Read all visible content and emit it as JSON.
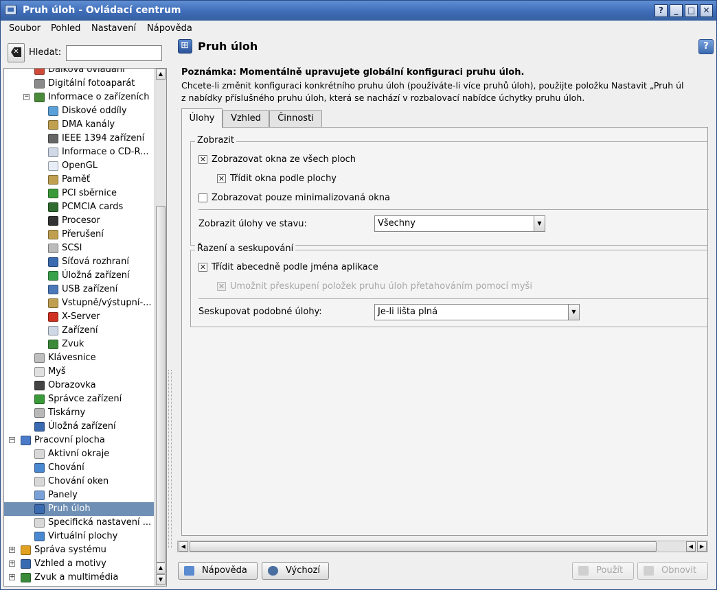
{
  "window": {
    "title": "Pruh úloh - Ovládací centrum",
    "buttons": [
      "?",
      "_",
      "□",
      "✕"
    ]
  },
  "menu": [
    "Soubor",
    "Pohled",
    "Nastavení",
    "Nápověda"
  ],
  "search": {
    "label": "Hledat:",
    "value": ""
  },
  "tree": {
    "items": [
      {
        "label": "Dálková ovládání",
        "level": 2,
        "color": "#d04a3a",
        "icon": "remote-icon"
      },
      {
        "label": "Digitální fotoaparát",
        "level": 2,
        "color": "#8a8a8a",
        "icon": "camera-icon"
      },
      {
        "label": "Informace o zařízeních",
        "level": 2,
        "color": "#4b8a3a",
        "icon": "info-icon",
        "expanded": true
      },
      {
        "label": "Diskové oddíly",
        "level": 3,
        "color": "#5aa0d8",
        "icon": "partition-icon"
      },
      {
        "label": "DMA kanály",
        "level": 3,
        "color": "#c0a050",
        "icon": "chip-icon"
      },
      {
        "label": "IEEE 1394 zařízení",
        "level": 3,
        "color": "#666666",
        "icon": "firewire-icon"
      },
      {
        "label": "Informace o CD-R...",
        "level": 3,
        "color": "#cfd8e6",
        "icon": "cdrom-icon"
      },
      {
        "label": "OpenGL",
        "level": 3,
        "color": "#e8eef8",
        "icon": "opengl-icon"
      },
      {
        "label": "Paměť",
        "level": 3,
        "color": "#c0a050",
        "icon": "memory-icon"
      },
      {
        "label": "PCI sběrnice",
        "level": 3,
        "color": "#3a9a3a",
        "icon": "pci-icon"
      },
      {
        "label": "PCMCIA cards",
        "level": 3,
        "color": "#2f6b2f",
        "icon": "pcmcia-icon"
      },
      {
        "label": "Procesor",
        "level": 3,
        "color": "#333333",
        "icon": "cpu-icon"
      },
      {
        "label": "Přerušení",
        "level": 3,
        "color": "#c0a050",
        "icon": "irq-icon"
      },
      {
        "label": "SCSI",
        "level": 3,
        "color": "#bbbbbb",
        "icon": "scsi-icon"
      },
      {
        "label": "Síťová rozhraní",
        "level": 3,
        "color": "#3a6ab0",
        "icon": "network-icon"
      },
      {
        "label": "Úložná zařízení",
        "level": 3,
        "color": "#3aa04a",
        "icon": "storage-icon"
      },
      {
        "label": "USB zařízení",
        "level": 3,
        "color": "#4a78b8",
        "icon": "usb-icon"
      },
      {
        "label": "Vstupně/výstupní-...",
        "level": 3,
        "color": "#c0a050",
        "icon": "io-icon"
      },
      {
        "label": "X-Server",
        "level": 3,
        "color": "#d03020",
        "icon": "xserver-icon"
      },
      {
        "label": "Zařízení",
        "level": 3,
        "color": "#cfd8e6",
        "icon": "devices-icon"
      },
      {
        "label": "Zvuk",
        "level": 3,
        "color": "#3a8a3a",
        "icon": "sound-icon"
      },
      {
        "label": "Klávesnice",
        "level": 2,
        "color": "#bfbfbf",
        "icon": "keyboard-icon"
      },
      {
        "label": "Myš",
        "level": 2,
        "color": "#e0e0e0",
        "icon": "mouse-icon"
      },
      {
        "label": "Obrazovka",
        "level": 2,
        "color": "#444444",
        "icon": "display-icon"
      },
      {
        "label": "Správce zařízení",
        "level": 2,
        "color": "#3a9a3a",
        "icon": "device-manager-icon"
      },
      {
        "label": "Tiskárny",
        "level": 2,
        "color": "#b8b8b8",
        "icon": "printer-icon"
      },
      {
        "label": "Úložná zařízení",
        "level": 2,
        "color": "#3a6ab0",
        "icon": "storage-icon"
      },
      {
        "label": "Pracovní plocha",
        "level": 1,
        "color": "#4a7ac8",
        "icon": "desktop-icon",
        "expanded": true
      },
      {
        "label": "Aktivní okraje",
        "level": 2,
        "color": "#d8d8d8",
        "icon": "borders-icon"
      },
      {
        "label": "Chování",
        "level": 2,
        "color": "#4a88d0",
        "icon": "behavior-icon"
      },
      {
        "label": "Chování oken",
        "level": 2,
        "color": "#d8d8d8",
        "icon": "window-behavior-icon"
      },
      {
        "label": "Panely",
        "level": 2,
        "color": "#7aa0d8",
        "icon": "panels-icon"
      },
      {
        "label": "Pruh úloh",
        "level": 2,
        "color": "#3a6ab0",
        "icon": "taskbar-icon",
        "selected": true
      },
      {
        "label": "Specifická nastavení ...",
        "level": 2,
        "color": "#d8d8d8",
        "icon": "window-specific-icon"
      },
      {
        "label": "Virtuální plochy",
        "level": 2,
        "color": "#4a88d0",
        "icon": "virtual-desktops-icon"
      },
      {
        "label": "Správa systému",
        "level": 1,
        "color": "#e0a020",
        "icon": "system-admin-icon",
        "collapsed": true
      },
      {
        "label": "Vzhled a motivy",
        "level": 1,
        "color": "#3a6ab0",
        "icon": "appearance-icon",
        "collapsed": true
      },
      {
        "label": "Zvuk a multimédia",
        "level": 1,
        "color": "#3a8a3a",
        "icon": "multimedia-icon",
        "collapsed": true
      }
    ]
  },
  "module": {
    "title": "Pruh úloh",
    "note_title": "Poznámka: Momentálně upravujete globální konfiguraci pruhu úloh.",
    "note_line1": "Chcete-li změnit konfiguraci konkrétního pruhu úloh (používáte-li více pruhů úloh), použijte položku Nastavit „Pruh úl",
    "note_line2": "z nabídky příslušného pruhu úloh, která se nachází v rozbalovací nabídce úchytky pruhu úloh.",
    "tabs": [
      "Úlohy",
      "Vzhled",
      "Činnosti"
    ]
  },
  "show_group": {
    "title": "Zobrazit",
    "show_all_desktops": "Zobrazovat okna ze všech ploch",
    "sort_by_desktop": "Třídit okna podle plochy",
    "only_minimized": "Zobrazovat pouze minimalizovaná okna",
    "state_label": "Zobrazit úlohy ve stavu:",
    "state_value": "Všechny"
  },
  "sort_group": {
    "title": "Řazení a seskupování",
    "sort_alpha": "Třídit abecedně podle jména aplikace",
    "allow_drag": "Umožnit přeskupení položek pruhu úloh přetahováním pomocí myši",
    "group_label": "Seskupovat podobné úlohy:",
    "group_value": "Je-li lišta plná"
  },
  "buttons": {
    "help": "Nápověda",
    "defaults": "Výchozí",
    "apply": "Použít",
    "reset": "Obnovit"
  }
}
